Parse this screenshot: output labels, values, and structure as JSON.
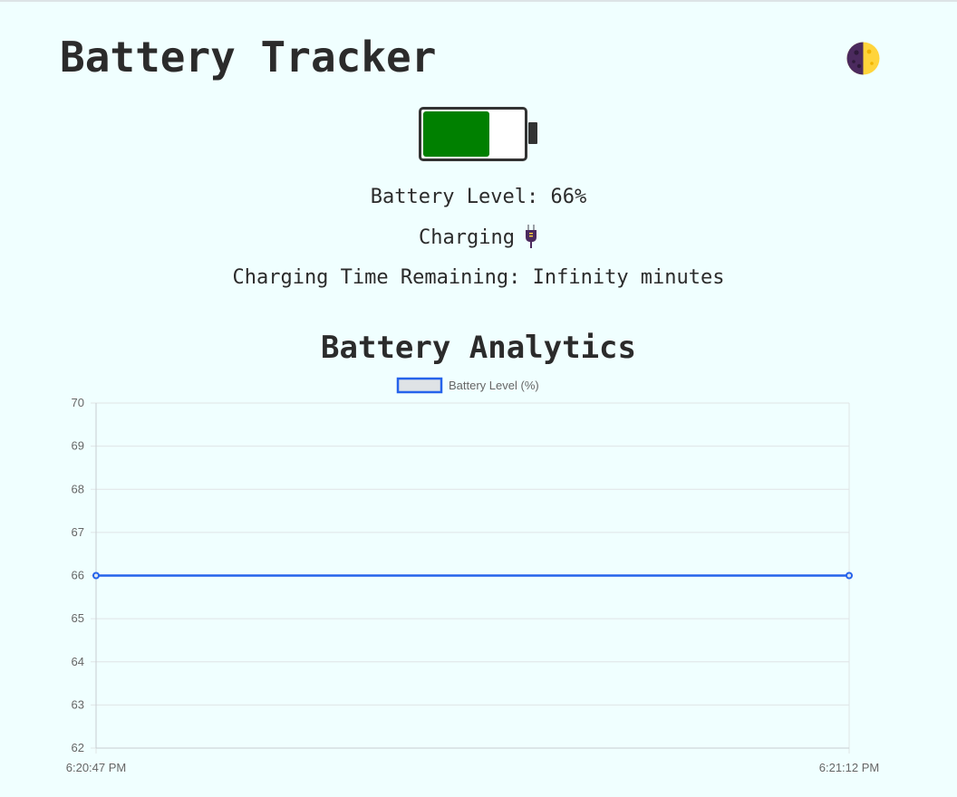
{
  "app": {
    "title": "Battery Tracker",
    "theme_toggle_icon": "half-moon-icon"
  },
  "battery": {
    "level_fraction": 0.66,
    "fill_color": "#008000",
    "level_text": "Battery Level: 66%",
    "charging_text": "Charging",
    "charging_icon": "electric-plug-icon",
    "time_text": "Charging Time Remaining: Infinity minutes"
  },
  "analytics": {
    "title": "Battery Analytics"
  },
  "chart_data": {
    "type": "line",
    "x": [
      "6:20:47 PM",
      "6:21:12 PM"
    ],
    "series": [
      {
        "name": "Battery Level (%)",
        "values": [
          66,
          66
        ],
        "color": "#2563eb"
      }
    ],
    "ylim": [
      62,
      70
    ],
    "yticks": [
      70,
      69,
      68,
      67,
      66,
      65,
      64,
      63,
      62
    ],
    "grid": true,
    "legend": "top-center"
  }
}
